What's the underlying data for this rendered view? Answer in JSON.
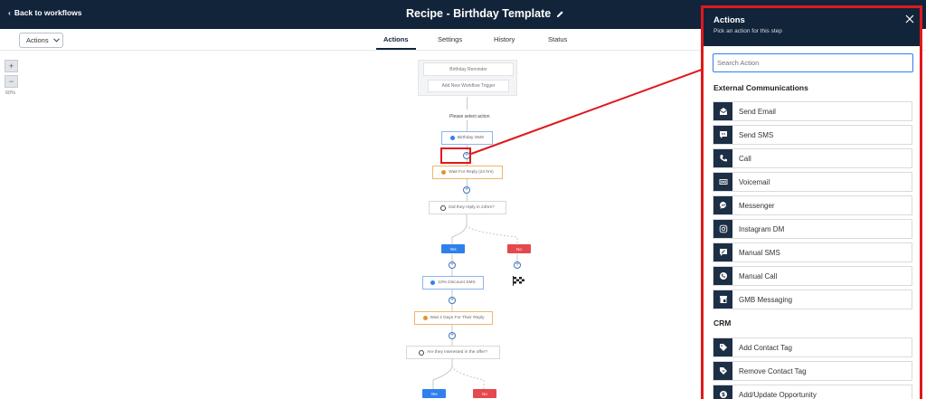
{
  "topbar": {
    "back_label": "Back to workflows",
    "title": "Recipe - Birthday Template"
  },
  "tabbar": {
    "actions_dropdown": "Actions",
    "tabs": [
      "Actions",
      "Settings",
      "History",
      "Status"
    ],
    "active_tab": "Actions"
  },
  "zoom": {
    "plus": "+",
    "minus": "−",
    "level": "60%"
  },
  "flow": {
    "trigger": "Birthday Reminder",
    "add_trigger": "Add New Workflow Trigger",
    "select_action": "Please select action",
    "node_birthday_sms": "Birthday SMS",
    "node_wait_reply": "Wait For Reply (24 hrs)",
    "node_did_reply": "Did they reply in 24hrs?",
    "yes": "Yes",
    "no": "No",
    "node_discount_sms": "10% Discount SMS",
    "node_wait_2days": "Wait 2 Days For Their Reply",
    "node_interested": "Are they interested in the offer?",
    "yes2": "Yes",
    "no2": "No"
  },
  "panel": {
    "title": "Actions",
    "subtitle": "Pick an action for this step",
    "search_placeholder": "Search Action",
    "sections": [
      {
        "heading": "External Communications",
        "items": [
          {
            "label": "Send Email",
            "icon": "email-icon"
          },
          {
            "label": "Send SMS",
            "icon": "sms-icon"
          },
          {
            "label": "Call",
            "icon": "phone-icon"
          },
          {
            "label": "Voicemail",
            "icon": "voicemail-icon"
          },
          {
            "label": "Messenger",
            "icon": "messenger-icon"
          },
          {
            "label": "Instagram DM",
            "icon": "instagram-icon"
          },
          {
            "label": "Manual SMS",
            "icon": "manual-sms-icon"
          },
          {
            "label": "Manual Call",
            "icon": "manual-call-icon"
          },
          {
            "label": "GMB Messaging",
            "icon": "gmb-icon"
          }
        ]
      },
      {
        "heading": "CRM",
        "items": [
          {
            "label": "Add Contact Tag",
            "icon": "tag-icon"
          },
          {
            "label": "Remove Contact Tag",
            "icon": "remove-tag-icon"
          },
          {
            "label": "Add/Update Opportunity",
            "icon": "dollar-icon"
          }
        ]
      }
    ]
  },
  "colors": {
    "header_bg": "#11243a",
    "highlight": "#e0181c",
    "accent_blue": "#2f80ed",
    "icon_bg": "#1d2f45"
  }
}
